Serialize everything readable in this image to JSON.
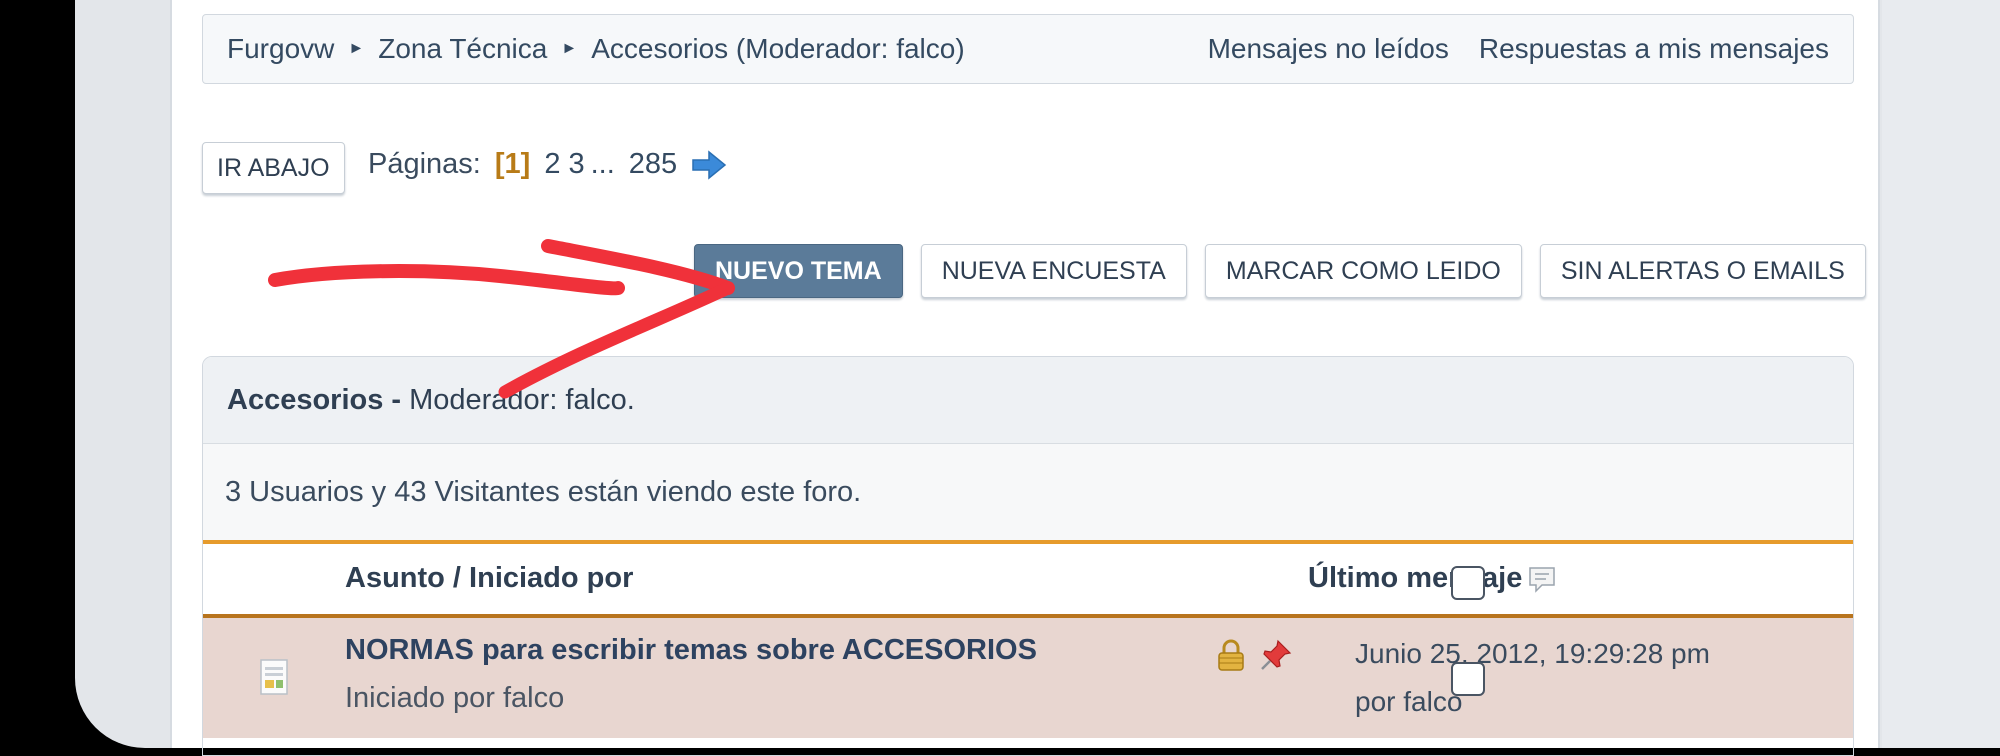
{
  "breadcrumb": {
    "items": [
      "Furgovw",
      "Zona Técnica",
      "Accesorios (Moderador: falco)"
    ],
    "separator": "►"
  },
  "nav_links": {
    "unread": "Mensajes no leídos",
    "replies": "Respuestas a mis mensajes"
  },
  "go_down_button": "IR ABAJO",
  "pagination": {
    "label": "Páginas:",
    "current": "[1]",
    "pages": [
      "2",
      "3"
    ],
    "ellipsis": "...",
    "last": "285"
  },
  "actions": {
    "new_topic": "NUEVO TEMA",
    "new_poll": "NUEVA ENCUESTA",
    "mark_read": "MARCAR COMO LEIDO",
    "no_alerts": "SIN ALERTAS O EMAILS"
  },
  "forum": {
    "name": "Accesorios -",
    "moderator": "Moderador: falco.",
    "viewers": "3 Usuarios y 43 Visitantes están viendo este foro."
  },
  "columns": {
    "subject": "Asunto / Iniciado por",
    "last_post": "Último mensaje"
  },
  "topics": [
    {
      "title": "NORMAS para escribir temas sobre ACCESORIOS",
      "starter": "Iniciado por falco",
      "date": "Junio 25, 2012, 19:29:28 pm",
      "by": "por falco",
      "locked": true,
      "sticky": true
    }
  ],
  "colors": {
    "primary_button": "#5b7b99",
    "accent_orange": "#e69b2c",
    "row_bg": "#e8d6d0",
    "annotation_red": "#f0313a"
  }
}
